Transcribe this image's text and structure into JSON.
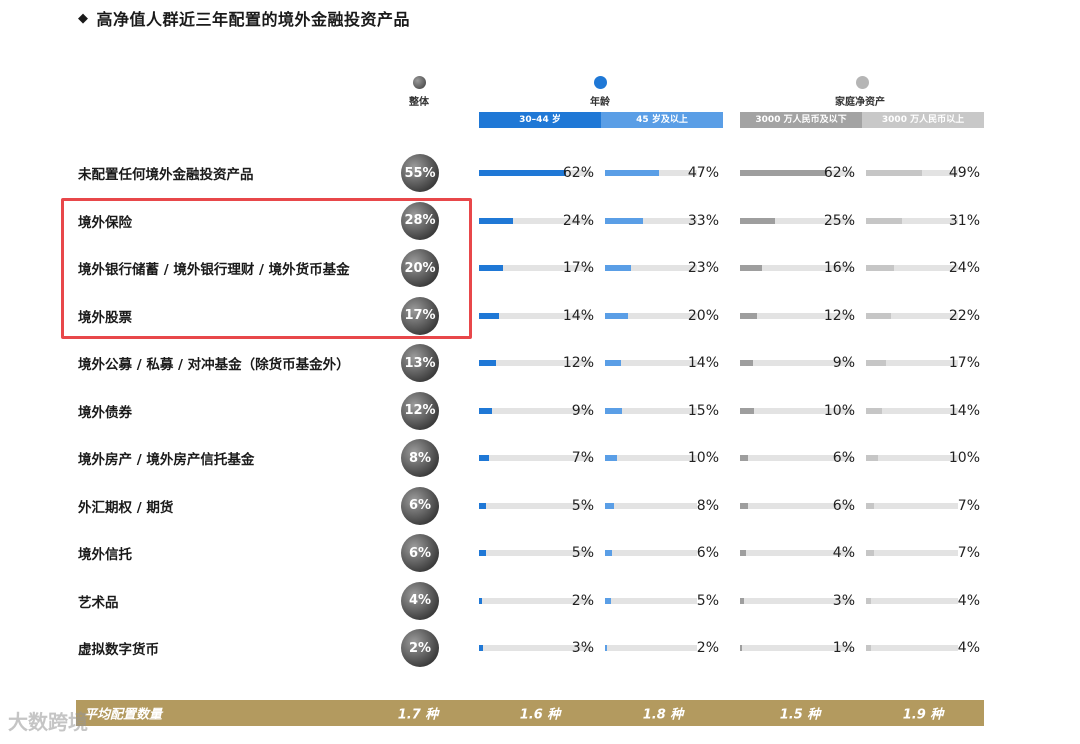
{
  "title": "高净值人群近三年配置的境外金融投资产品",
  "headers": {
    "overall": "整体",
    "age": "年龄",
    "wealth": "家庭净资产",
    "age_groups": [
      "30–44 岁",
      "45 岁及以上"
    ],
    "wealth_groups": [
      "3000 万人民币及以下",
      "3000 万人民币以上"
    ]
  },
  "colors": {
    "age_1": "#1f78d6",
    "age_2": "#5a9ee6",
    "wealth_1": "#9e9e9e",
    "wealth_2": "#c6c6c6",
    "highlight": "#e8474a",
    "footer": "#b39a5f"
  },
  "chart_data": {
    "type": "bar",
    "title": "高净值人群近三年配置的境外金融投资产品",
    "categories": [
      "未配置任何境外金融投资产品",
      "境外保险",
      "境外银行储蓄 / 境外银行理财 / 境外货币基金",
      "境外股票",
      "境外公募 / 私募 / 对冲基金（除货币基金外）",
      "境外债券",
      "境外房产 / 境外房产信托基金",
      "外汇期权 / 期货",
      "境外信托",
      "艺术品",
      "虚拟数字货币"
    ],
    "series": [
      {
        "name": "整体",
        "values": [
          55,
          28,
          20,
          17,
          13,
          12,
          8,
          6,
          6,
          4,
          2
        ]
      },
      {
        "name": "30–44 岁",
        "values": [
          62,
          24,
          17,
          14,
          12,
          9,
          7,
          5,
          5,
          2,
          3
        ]
      },
      {
        "name": "45 岁及以上",
        "values": [
          47,
          33,
          23,
          20,
          14,
          15,
          10,
          8,
          6,
          5,
          2
        ]
      },
      {
        "name": "3000 万人民币及以下",
        "values": [
          62,
          25,
          16,
          12,
          9,
          10,
          6,
          6,
          4,
          3,
          1
        ]
      },
      {
        "name": "3000 万人民币以上",
        "values": [
          49,
          31,
          24,
          22,
          17,
          14,
          10,
          7,
          7,
          4,
          4
        ]
      }
    ],
    "unit": "%",
    "ylim": [
      0,
      100
    ],
    "highlighted_categories": [
      "境外保险",
      "境外银行储蓄 / 境外银行理财 / 境外货币基金",
      "境外股票"
    ]
  },
  "footer": {
    "label": "平均配置数量",
    "values": [
      "1.7 种",
      "1.6 种",
      "1.8 种",
      "1.5 种",
      "1.9 种"
    ]
  },
  "watermark": "大数跨境"
}
